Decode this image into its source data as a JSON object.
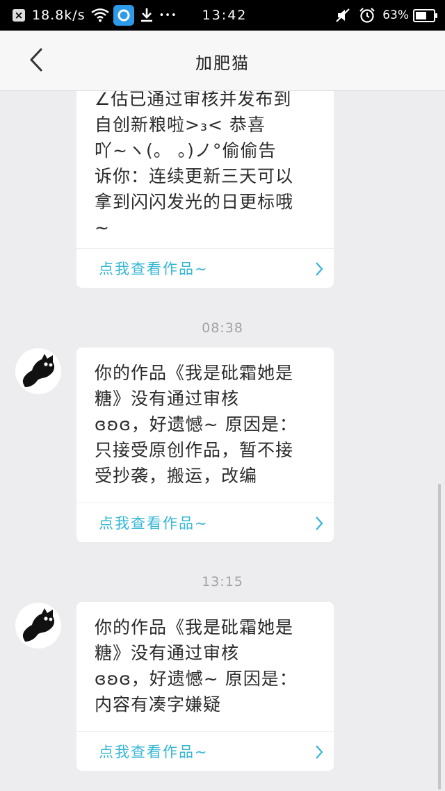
{
  "status_bar": {
    "close_glyph": "×",
    "speed": "18.8k/s",
    "dots": "•••",
    "time": "13:42",
    "battery": "63%",
    "battery_level": 0.63
  },
  "header": {
    "title": "加肥猫"
  },
  "messages": [
    {
      "text": "∠估已通过审核并发布到\n自创新粮啦>₃< 恭喜\n吖~ヽ(。  。)ノ°偷偷告\n诉你：连续更新三天可以\n拿到闪闪发光的日更标哦\n~",
      "link": "点我查看作品~"
    },
    {
      "time": "08:38",
      "text": "你的作品《我是砒霜她是\n糖》没有通过审核\nɞʚɞ，好遗憾~ 原因是：\n只接受原创作品，暂不接\n受抄袭，搬运，改编",
      "link": "点我查看作品~"
    },
    {
      "time": "13:15",
      "text": "你的作品《我是砒霜她是\n糖》没有通过审核\nɞʚɞ，好遗憾~ 原因是：\n内容有凑字嫌疑",
      "link": "点我查看作品~"
    }
  ],
  "colors": {
    "accent_link": "#35b6d6",
    "background": "#ededf0",
    "status_bar": "#000000"
  },
  "icons": {
    "back": "back-arrow-icon",
    "chevron": "chevron-right-icon",
    "avatar": "black-cat-avatar"
  }
}
